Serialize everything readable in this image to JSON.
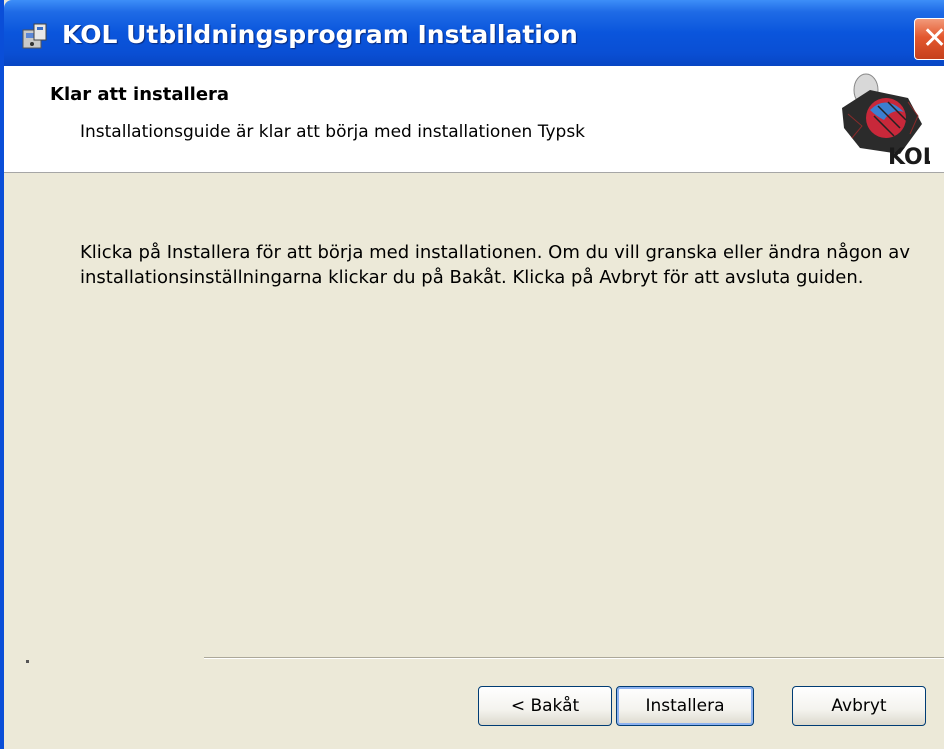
{
  "window": {
    "title": "KOL Utbildningsprogram Installation"
  },
  "header": {
    "title": "Klar att installera",
    "subtitle": "Installationsguide är klar att börja med installationen Typsk",
    "logo_text": "KOL"
  },
  "body": {
    "text": "Klicka på Installera för att börja med installationen.  Om du vill granska eller ändra någon av installationsinställningarna klickar du på Bakåt.  Klicka på Avbryt för att avsluta guiden."
  },
  "buttons": {
    "back": "< Bakåt",
    "install": "Installera",
    "cancel": "Avbryt"
  },
  "icons": {
    "title": "installer-icon",
    "close": "close-icon",
    "logo": "kol-logo"
  },
  "colors": {
    "titlebar": "#0a55dc",
    "close": "#e3582f",
    "dialog_bg": "#ece9d8"
  }
}
